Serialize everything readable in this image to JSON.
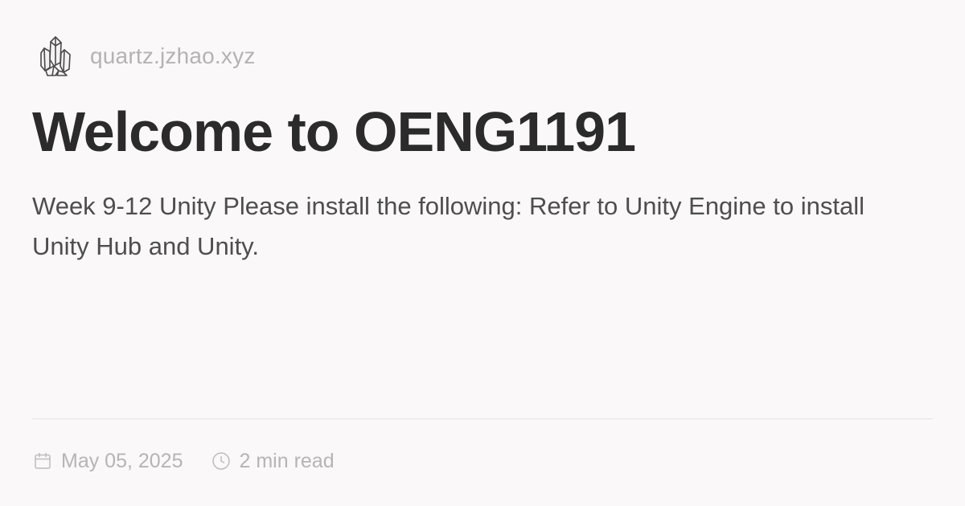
{
  "site": {
    "name": "quartz.jzhao.xyz",
    "logo_icon": "crystal-cluster-icon"
  },
  "page": {
    "title": "Welcome to OENG1191",
    "description": "Week 9-12 Unity Please install the following: Refer to Unity Engine to install Unity Hub and Unity."
  },
  "meta": {
    "date": "May 05, 2025",
    "date_icon": "calendar-icon",
    "reading_time": "2 min read",
    "reading_time_icon": "clock-icon"
  },
  "colors": {
    "background": "#faf8f8",
    "title": "#2b2b2b",
    "description": "#4e4e4e",
    "muted": "#b3b3b3",
    "divider": "#e5e2e2"
  }
}
